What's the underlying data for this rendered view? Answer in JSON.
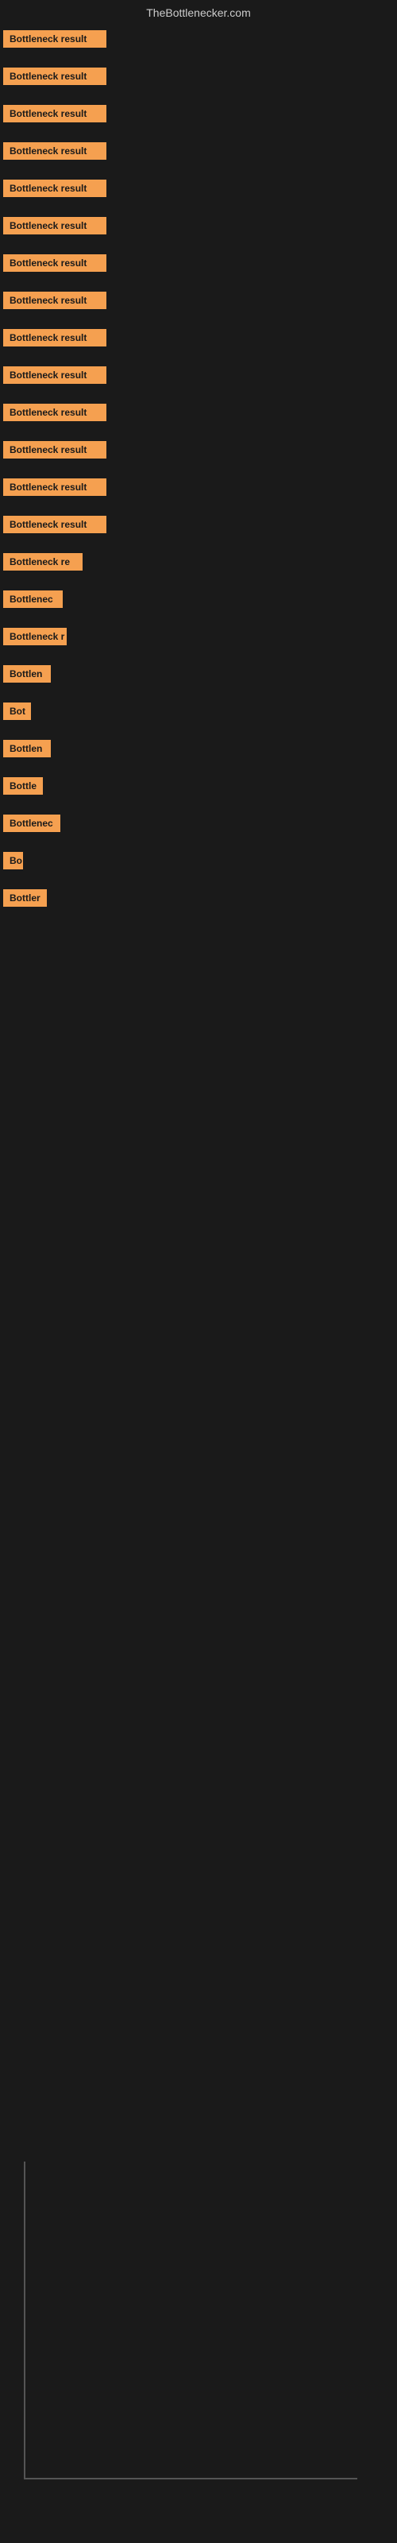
{
  "site": {
    "title": "TheBottlenecker.com"
  },
  "bars": [
    {
      "id": 1,
      "label": "Bottleneck result",
      "width": 130
    },
    {
      "id": 2,
      "label": "Bottleneck result",
      "width": 130
    },
    {
      "id": 3,
      "label": "Bottleneck result",
      "width": 130
    },
    {
      "id": 4,
      "label": "Bottleneck result",
      "width": 130
    },
    {
      "id": 5,
      "label": "Bottleneck result",
      "width": 130
    },
    {
      "id": 6,
      "label": "Bottleneck result",
      "width": 130
    },
    {
      "id": 7,
      "label": "Bottleneck result",
      "width": 130
    },
    {
      "id": 8,
      "label": "Bottleneck result",
      "width": 130
    },
    {
      "id": 9,
      "label": "Bottleneck result",
      "width": 130
    },
    {
      "id": 10,
      "label": "Bottleneck result",
      "width": 130
    },
    {
      "id": 11,
      "label": "Bottleneck result",
      "width": 130
    },
    {
      "id": 12,
      "label": "Bottleneck result",
      "width": 130
    },
    {
      "id": 13,
      "label": "Bottleneck result",
      "width": 130
    },
    {
      "id": 14,
      "label": "Bottleneck result",
      "width": 130
    },
    {
      "id": 15,
      "label": "Bottleneck re",
      "width": 100
    },
    {
      "id": 16,
      "label": "Bottlenec",
      "width": 75
    },
    {
      "id": 17,
      "label": "Bottleneck r",
      "width": 80
    },
    {
      "id": 18,
      "label": "Bottlen",
      "width": 60
    },
    {
      "id": 19,
      "label": "Bot",
      "width": 35
    },
    {
      "id": 20,
      "label": "Bottlen",
      "width": 60
    },
    {
      "id": 21,
      "label": "Bottle",
      "width": 50
    },
    {
      "id": 22,
      "label": "Bottlenec",
      "width": 72
    },
    {
      "id": 23,
      "label": "Bo",
      "width": 25
    },
    {
      "id": 24,
      "label": "Bottler",
      "width": 55
    }
  ],
  "colors": {
    "bar_bg": "#f5a050",
    "bar_text": "#1a1a1a",
    "page_bg": "#1a1a1a",
    "title_text": "#cccccc"
  }
}
